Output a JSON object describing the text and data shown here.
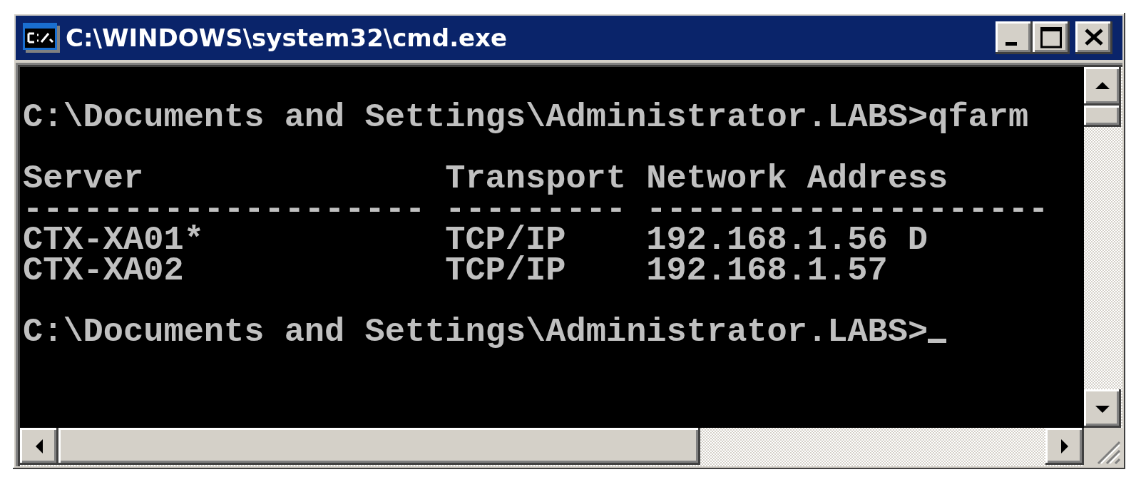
{
  "window": {
    "title": "C:\\WINDOWS\\system32\\cmd.exe"
  },
  "console": {
    "command_line": "C:\\Documents and Settings\\Administrator.LABS>qfarm",
    "table": {
      "columns": [
        {
          "label": "Server",
          "rule": "--------------------"
        },
        {
          "label": "Transport",
          "rule": "---------"
        },
        {
          "label": "Network Address",
          "rule": "--------------------"
        }
      ],
      "rows": [
        [
          "CTX-XA01*",
          "TCP/IP",
          "192.168.1.56 D"
        ],
        [
          "CTX-XA02",
          "TCP/IP",
          "192.168.1.57"
        ]
      ]
    },
    "prompt": "C:\\Documents and Settings\\Administrator.LABS>"
  }
}
